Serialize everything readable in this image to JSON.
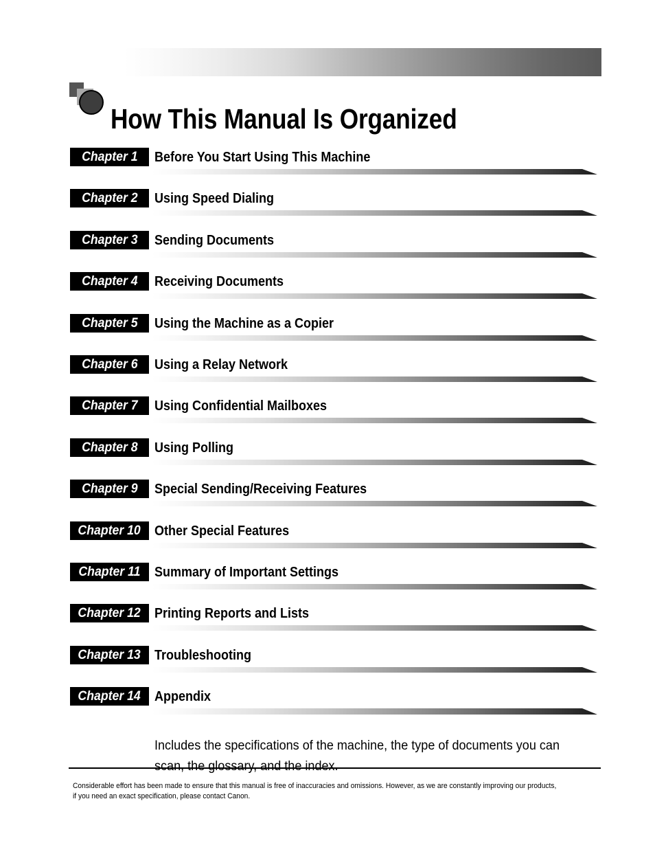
{
  "page": {
    "title": "How This Manual Is Organized",
    "logo_icon": "square-square-circle-logo-icon"
  },
  "colors": {
    "badge_background": "#000000",
    "badge_text": "#ffffff",
    "bar_gradient_start": "#ffffff",
    "bar_gradient_end": "#1c1c1c",
    "header_gradient_start": "#ffffff",
    "header_gradient_end": "#595959",
    "text": "#000000"
  },
  "chapters": [
    {
      "label": "Chapter 1",
      "title": "Before You Start Using This Machine"
    },
    {
      "label": "Chapter 2",
      "title": "Using Speed Dialing"
    },
    {
      "label": "Chapter 3",
      "title": "Sending Documents"
    },
    {
      "label": "Chapter 4",
      "title": "Receiving Documents"
    },
    {
      "label": "Chapter 5",
      "title": "Using the Machine as a Copier"
    },
    {
      "label": "Chapter 6",
      "title": "Using a Relay Network"
    },
    {
      "label": "Chapter 7",
      "title": "Using Confidential Mailboxes"
    },
    {
      "label": "Chapter 8",
      "title": "Using Polling"
    },
    {
      "label": "Chapter 9",
      "title": "Special Sending/Receiving Features"
    },
    {
      "label": "Chapter 10",
      "title": "Other Special Features"
    },
    {
      "label": "Chapter 11",
      "title": "Summary of Important Settings"
    },
    {
      "label": "Chapter 12",
      "title": "Printing Reports and Lists"
    },
    {
      "label": "Chapter 13",
      "title": "Troubleshooting"
    },
    {
      "label": "Chapter 14",
      "title": "Appendix"
    }
  ],
  "appendix_description": "Includes the specifications of the machine, the type of documents you can scan, the glossary, and the index.",
  "footer_note": "Considerable effort has been made to ensure that this manual is free of inaccuracies and omissions. However, as we are constantly improving our products, if you need an exact specification, please contact Canon."
}
